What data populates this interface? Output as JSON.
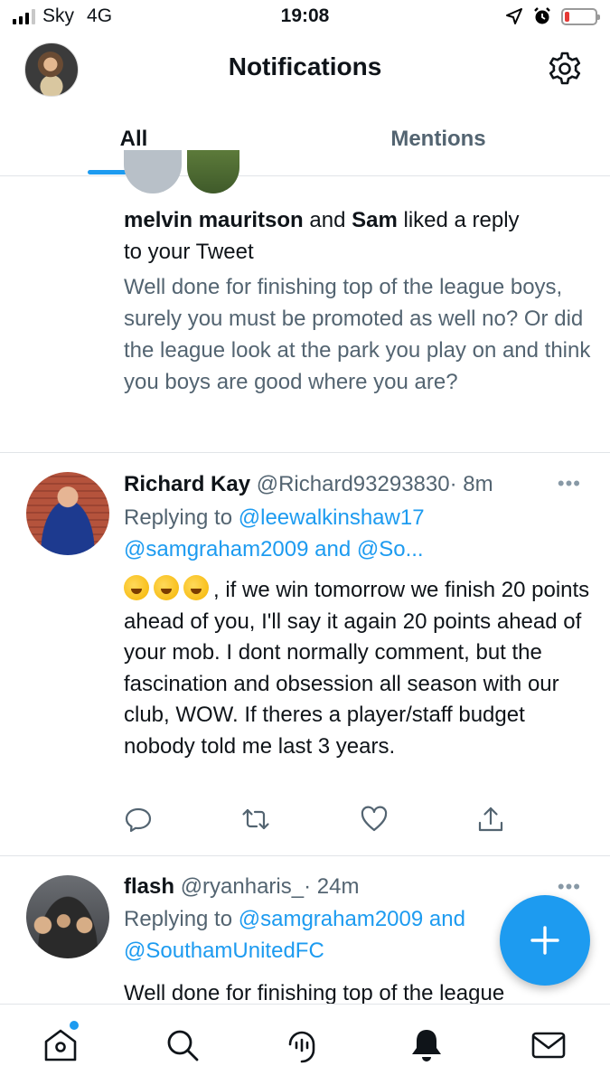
{
  "status_bar": {
    "carrier": "Sky",
    "network": "4G",
    "time": "19:08",
    "battery_level": 0.15,
    "battery_color": "#e53935"
  },
  "header": {
    "title": "Notifications",
    "avatar_icon": "profile-avatar",
    "settings_icon": "gear-icon"
  },
  "tabs": [
    {
      "label": "All",
      "selected": true
    },
    {
      "label": "Mentions",
      "selected": false
    }
  ],
  "notification": {
    "user1": "melvin mauritson",
    "connector": "and",
    "user2": "Sam",
    "action": "liked a reply",
    "action2": "to your Tweet",
    "quoted_text": "Well done for finishing top of the league boys, surely you must be promoted as well no? Or did the league look at the park you play on and think you boys are good where you are?"
  },
  "tweets": [
    {
      "name": "Richard Kay",
      "handle": "@Richard93293830",
      "time": "· 8m",
      "more": "•••",
      "replying_prefix": "Replying to",
      "reply_to_1": "@leewalkinshaw17",
      "reply_to_2": "@samgraham2009 and @So...",
      "body": ", if we win tomorrow we finish 20 points ahead of you, I'll say it again 20 points ahead of your mob. I dont normally comment, but the fascination and obsession all season with our club, WOW. If theres a player/staff budget nobody told me last 3 years."
    },
    {
      "name": "flash",
      "handle": "@ryanharis_",
      "time": "· 24m",
      "more": "•••",
      "replying_prefix": "Replying to",
      "reply_to_1": "@samgraham2009 and",
      "reply_to_2": "@SouthamUnitedFC",
      "body": "Well done for finishing top of the league"
    }
  ],
  "actions": [
    "reply-icon",
    "retweet-icon",
    "like-icon",
    "share-icon"
  ],
  "fab": {
    "icon": "compose-plus-icon",
    "color": "#1d9bf0"
  },
  "bottom_nav": [
    "home-icon",
    "search-icon",
    "spaces-icon",
    "notifications-bell-icon",
    "messages-icon"
  ]
}
